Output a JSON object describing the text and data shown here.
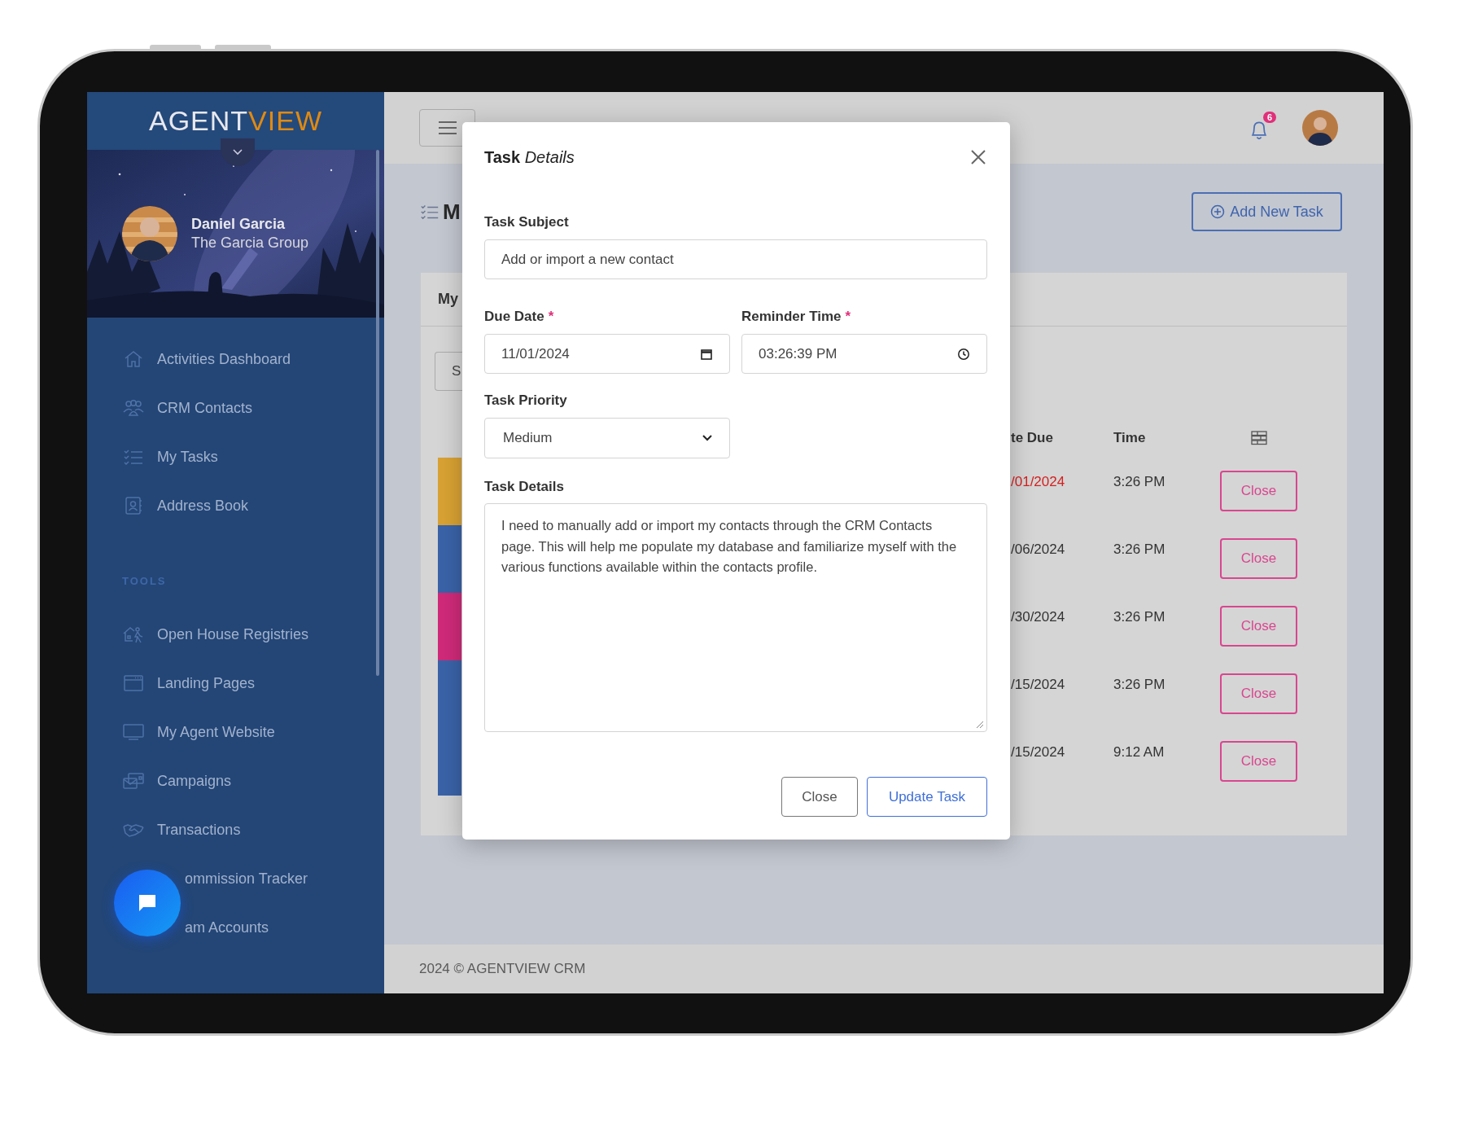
{
  "sidebar": {
    "logo": {
      "primary": "AGENT",
      "accent": "VIEW"
    },
    "profile": {
      "name": "Daniel Garcia",
      "company": "The Garcia Group"
    },
    "nav": [
      {
        "label": "Activities Dashboard",
        "kind": "link"
      },
      {
        "label": "CRM Contacts",
        "kind": "link"
      },
      {
        "label": "My Tasks",
        "kind": "link"
      },
      {
        "label": "Address Book",
        "kind": "link"
      }
    ],
    "section_label": "TOOLS",
    "tools": [
      {
        "label": "Open House Registries",
        "kind": "link"
      },
      {
        "label": "Landing Pages",
        "kind": "link"
      },
      {
        "label": "My Agent Website",
        "kind": "link"
      },
      {
        "label": "Campaigns",
        "kind": "link"
      },
      {
        "label": "Transactions",
        "kind": "link"
      },
      {
        "label": "ommission Tracker",
        "kind": "covered"
      },
      {
        "label": "am Accounts",
        "kind": "covered"
      }
    ]
  },
  "topbar": {
    "notification_count": "6"
  },
  "page": {
    "title": "M",
    "add_button": "Add New Task"
  },
  "card": {
    "title": "My",
    "search_button": "S",
    "columns": [
      "te Due",
      "Time"
    ],
    "rows": [
      {
        "date": "/01/2024",
        "overdue": true,
        "time": "3:26 PM",
        "action": "Close",
        "color": "#d9a233"
      },
      {
        "date": "/06/2024",
        "overdue": false,
        "time": "3:26 PM",
        "action": "Close",
        "color": "#3a63a8"
      },
      {
        "date": "/30/2024",
        "overdue": false,
        "time": "3:26 PM",
        "action": "Close",
        "color": "#d02a7a"
      },
      {
        "date": "/15/2024",
        "overdue": false,
        "time": "3:26 PM",
        "action": "Close",
        "color": "#3a63a8"
      },
      {
        "date": "/15/2024",
        "overdue": false,
        "time": "9:12 AM",
        "action": "Close",
        "color": "#3a63a8"
      }
    ]
  },
  "modal": {
    "title": "**Task** *Details*",
    "subject": {
      "label": "Task Subject",
      "value": "Add or import a new contact"
    },
    "due_date": {
      "label": "Due Date",
      "required_mark": "*",
      "value": "11/01/2024"
    },
    "reminder_time": {
      "label": "Reminder Time",
      "required_mark": "*",
      "value": "03:26:39 PM"
    },
    "priority": {
      "label": "Task Priority",
      "value": "Medium"
    },
    "details": {
      "label": "Task Details",
      "value": "I need to manually add or import my contacts through the CRM Contacts page. This will help me populate my database and familiarize myself with the various functions available within the contacts profile."
    },
    "buttons": {
      "close": "Close",
      "update": "Update Task"
    }
  },
  "footer": "2024 © AGENTVIEW CRM"
}
